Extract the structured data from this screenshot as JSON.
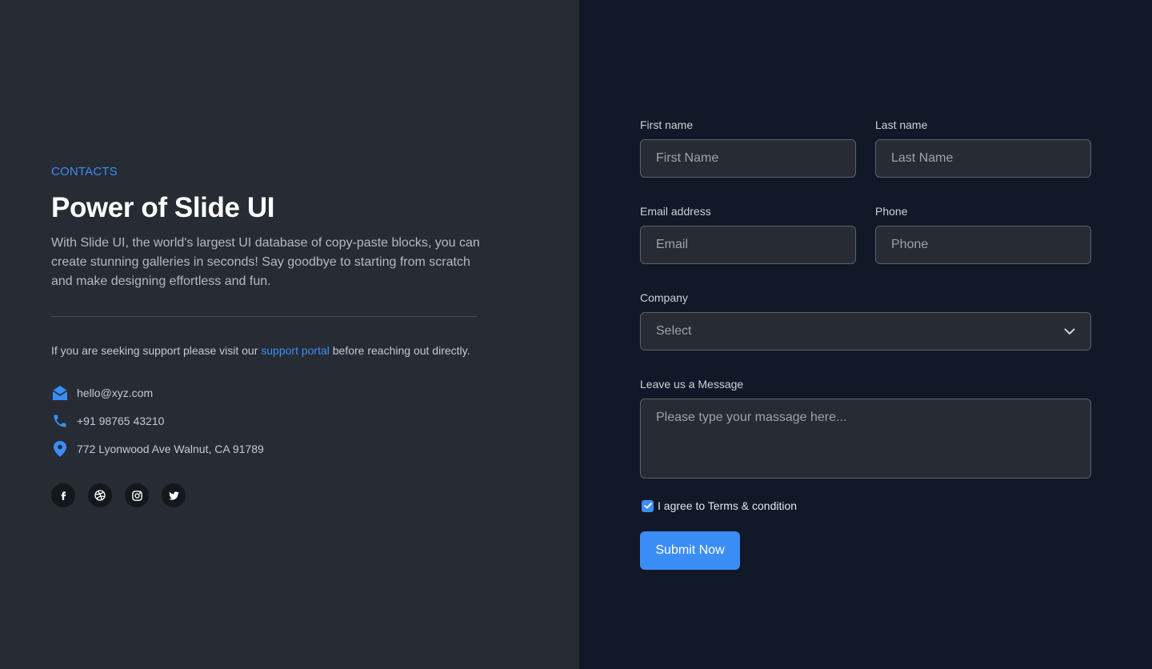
{
  "colors": {
    "accent": "#3b8df6",
    "left_bg": "#262b34",
    "right_bg": "#111827",
    "input_bg": "#262b34"
  },
  "left": {
    "eyebrow": "CONTACTS",
    "title": "Power of Slide UI",
    "description": "With Slide UI, the world's largest UI database of copy-paste blocks, you can create stunning galleries in seconds! Say goodbye to starting from scratch and make designing effortless and fun.",
    "support_prefix": "If you are seeking support please visit our ",
    "support_link": "support portal",
    "support_suffix": " before reaching out directly.",
    "contacts": [
      {
        "icon": "mail-icon",
        "text": "hello@xyz.com"
      },
      {
        "icon": "phone-icon",
        "text": "+91 98765 43210"
      },
      {
        "icon": "location-pin-icon",
        "text": "772 Lyonwood Ave Walnut, CA 91789"
      }
    ],
    "socials": [
      "facebook-icon",
      "dribbble-icon",
      "instagram-icon",
      "twitter-icon"
    ]
  },
  "form": {
    "first_name": {
      "label": "First name",
      "placeholder": "First Name"
    },
    "last_name": {
      "label": "Last name",
      "placeholder": "Last Name"
    },
    "email": {
      "label": "Email address",
      "placeholder": "Email"
    },
    "phone": {
      "label": "Phone",
      "placeholder": "Phone"
    },
    "company": {
      "label": "Company",
      "selected": "Select"
    },
    "message": {
      "label": "Leave us a Message",
      "placeholder": "Please type your massage here..."
    },
    "agree": {
      "label": "I agree to Terms & condition",
      "checked": true
    },
    "submit_label": "Submit Now"
  }
}
